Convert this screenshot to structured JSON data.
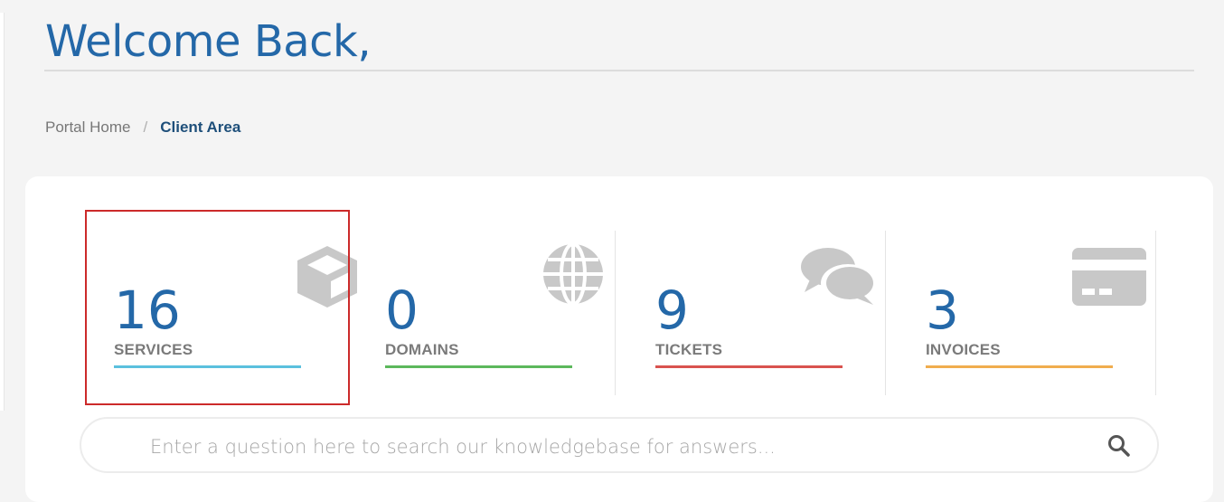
{
  "header": {
    "title": "Welcome Back,"
  },
  "breadcrumb": {
    "home": "Portal Home",
    "separator": "/",
    "current": "Client Area"
  },
  "stats": [
    {
      "count": "16",
      "label": "SERVICES",
      "icon": "cube-icon",
      "color": "#5bc0de"
    },
    {
      "count": "0",
      "label": "DOMAINS",
      "icon": "globe-icon",
      "color": "#5cb85c"
    },
    {
      "count": "9",
      "label": "TICKETS",
      "icon": "comments-icon",
      "color": "#d9534f"
    },
    {
      "count": "3",
      "label": "INVOICES",
      "icon": "credit-card-icon",
      "color": "#f0ad4e"
    }
  ],
  "search": {
    "placeholder": "Enter a question here to search our knowledgebase for answers..."
  }
}
